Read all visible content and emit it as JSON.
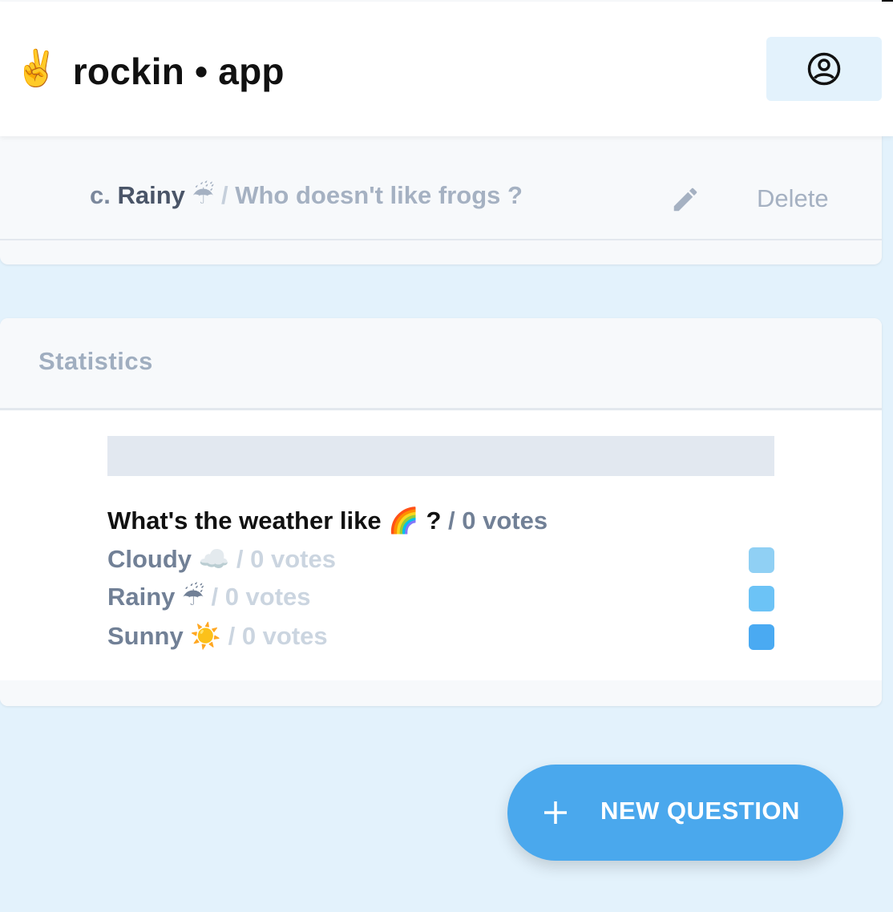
{
  "header": {
    "brand_emoji": "✌️",
    "app_title": "rockin • app",
    "account_icon": "account-circle-icon"
  },
  "answer": {
    "letter": "c.",
    "name": "Rainy",
    "emoji": "☔",
    "separator": "/",
    "text": "Who doesn't like frogs ?",
    "edit_icon": "pencil-icon",
    "delete_label": "Delete"
  },
  "statistics": {
    "title": "Statistics",
    "question": {
      "text": "What's the weather like",
      "emoji": "🌈",
      "suffix": "?",
      "votes": "/ 0 votes"
    },
    "options": [
      {
        "label": "Cloudy",
        "emoji": "☁️",
        "votes": "/ 0 votes",
        "color": "#90d0f4"
      },
      {
        "label": "Rainy",
        "emoji": "☔",
        "votes": "/ 0 votes",
        "color": "#6cc3f6"
      },
      {
        "label": "Sunny",
        "emoji": "☀️",
        "votes": "/ 0 votes",
        "color": "#4aaaf2"
      }
    ]
  },
  "fab": {
    "icon": "plus-icon",
    "label": "NEW QUESTION"
  },
  "colors": {
    "background": "#e3f2fc",
    "accent": "#4aa8ed"
  }
}
